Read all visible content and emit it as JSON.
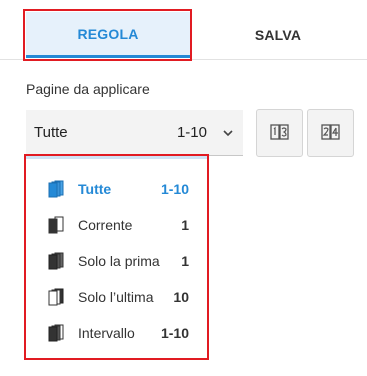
{
  "tabs": [
    {
      "label": "REGOLA",
      "active": true
    },
    {
      "label": "SALVA",
      "active": false
    }
  ],
  "pages_section": {
    "label": "Pagine da applicare",
    "selected_value": "Tutte",
    "selected_range": "1-10"
  },
  "dropdown": {
    "options": [
      {
        "label": "Tutte",
        "count": "1-10",
        "icon": "all-pages-icon",
        "selected": true
      },
      {
        "label": "Corrente",
        "count": "1",
        "icon": "current-page-icon",
        "selected": false
      },
      {
        "label": "Solo la prima",
        "count": "1",
        "icon": "first-page-icon",
        "selected": false
      },
      {
        "label": "Solo l’ultima",
        "count": "10",
        "icon": "last-page-icon",
        "selected": false
      },
      {
        "label": "Intervallo",
        "count": "1-10",
        "icon": "page-range-icon",
        "selected": false
      }
    ]
  },
  "colors": {
    "accent": "#2489d6",
    "highlight": "#e11b22",
    "tab_active_bg": "#e6f1fb"
  }
}
